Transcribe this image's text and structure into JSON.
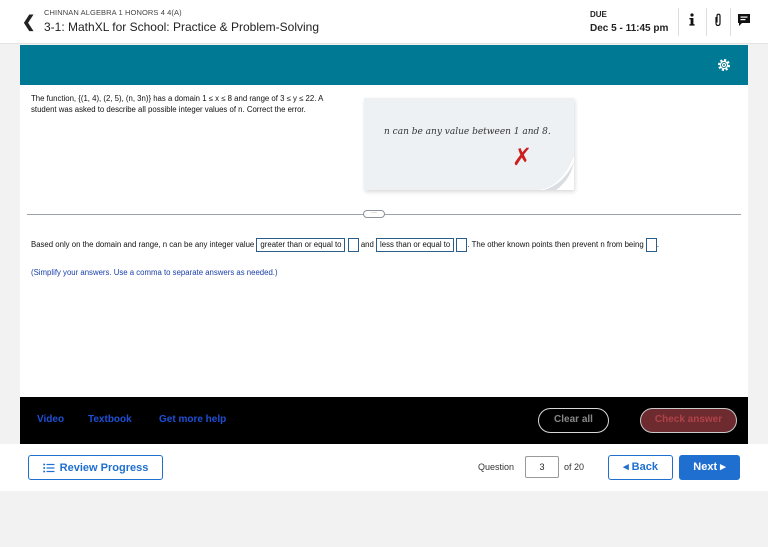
{
  "header": {
    "course": "CHINNAN ALGEBRA 1 HONORS 4 4(A)",
    "assignment": "3-1: MathXL for School: Practice & Problem-Solving",
    "due_label": "DUE",
    "due_value": "Dec 5 - 11:45 pm"
  },
  "question": {
    "prompt": "The function, {(1, 4), (2, 5), (n, 3n)} has a domain 1 ≤ x ≤ 8 and range of 3 ≤ y ≤ 22. A student was asked to describe all possible integer values of n. Correct the error.",
    "student_note": "n can be any value between 1 and 8.",
    "answer_prefix": "Based only on the domain and range, n can be any integer value",
    "select_1": "greater than or equal to",
    "and_word": "and",
    "select_2": "less than or equal to",
    "answer_suffix": ". The other known points then prevent n from being",
    "answer_end": ".",
    "hint": "(Simplify your answers. Use a comma to separate answers as needed.)"
  },
  "footer": {
    "video": "Video",
    "textbook": "Textbook",
    "help": "Get more help",
    "clear": "Clear all",
    "check": "Check answer"
  },
  "nav": {
    "review": "Review Progress",
    "question_label": "Question",
    "question_number": "3",
    "of_total": "of 20",
    "back": "◂ Back",
    "next": "Next ▸"
  },
  "colors": {
    "teal": "#007a94",
    "link_blue": "#1f4fd6",
    "button_blue": "#1f6fd0",
    "error_red": "#cc1f1f"
  }
}
